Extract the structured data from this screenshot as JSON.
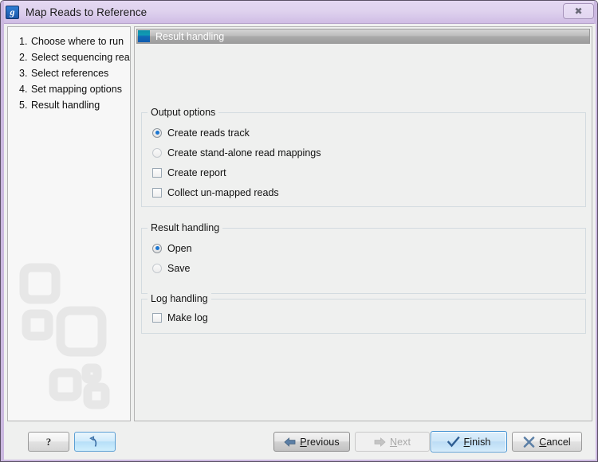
{
  "window": {
    "title": "Map Reads to Reference",
    "app_icon": "clc-workbench-icon",
    "close_label": "✕"
  },
  "sidebar": {
    "steps": [
      {
        "num": "1.",
        "label": "Choose where to run"
      },
      {
        "num": "2.",
        "label": "Select sequencing reads"
      },
      {
        "num": "3.",
        "label": "Select references"
      },
      {
        "num": "4.",
        "label": "Set mapping options"
      },
      {
        "num": "5.",
        "label": "Result handling"
      }
    ]
  },
  "content": {
    "header_title": "Result handling",
    "groups": [
      {
        "title": "Output options",
        "options": [
          {
            "type": "radio",
            "label": "Create reads track",
            "checked": true
          },
          {
            "type": "radio",
            "label": "Create stand-alone read mappings",
            "checked": false
          },
          {
            "type": "checkbox",
            "label": "Create report",
            "checked": false
          },
          {
            "type": "checkbox",
            "label": "Collect un-mapped reads",
            "checked": false
          }
        ]
      },
      {
        "title": "Result handling",
        "options": [
          {
            "type": "radio",
            "label": "Open",
            "checked": true
          },
          {
            "type": "radio",
            "label": "Save",
            "checked": false
          }
        ]
      },
      {
        "title": "Log handling",
        "options": [
          {
            "type": "checkbox",
            "label": "Make log",
            "checked": false
          }
        ]
      }
    ]
  },
  "buttons": {
    "help": "?",
    "reset_icon": "undo-arrow-icon",
    "previous": {
      "pre": "",
      "mnemonic": "P",
      "post": "revious"
    },
    "next": {
      "pre": "",
      "mnemonic": "N",
      "post": "ext"
    },
    "finish": {
      "pre": "",
      "mnemonic": "F",
      "post": "inish"
    },
    "cancel": {
      "pre": "",
      "mnemonic": "C",
      "post": "ancel"
    }
  },
  "colors": {
    "titlebar": "#ded0ee",
    "frame": "#cbb8e0",
    "accent_blue": "#1b76d1",
    "header_icon_teal": "#0f9ab4",
    "finish_highlight": "#bcdcf5"
  }
}
